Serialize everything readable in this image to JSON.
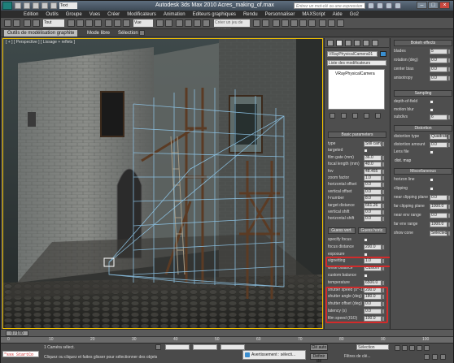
{
  "window": {
    "title": "Autodesk 3ds Max 2010     Acres_making_of.max",
    "help_search_placeholder": "Entrez un mot-clé ou une expression",
    "quick_access_dropdown": "Text"
  },
  "menu": [
    "Edition",
    "Outils",
    "Groupe",
    "Vues",
    "Créer",
    "Modificateurs",
    "Animation",
    "Editeurs graphiques",
    "Rendu",
    "Personnaliser",
    "MAXScript",
    "Aide",
    "Go2"
  ],
  "toolbar": {
    "dropdown_all": "Tout",
    "dropdown_vue": "Vue",
    "selection_set": "Créer un jeu de sélection"
  },
  "ribbon": {
    "tabs": [
      "Outils de modélisation graphite",
      "Mode libre",
      "Sélection"
    ]
  },
  "viewport": {
    "label": "[ + ] [ Perspective ] [ Lissage + reflets ]"
  },
  "command_panel": {
    "object_name": "VRayPhysicalCamera01",
    "modifier_list": "Liste des modificateurs",
    "modifier_item": "VRayPhysicalCamera",
    "rollout_title": "Basic parameters",
    "params": [
      {
        "label": "type",
        "value": "Still cam"
      },
      {
        "label": "targeted",
        "value": ""
      },
      {
        "label": "film gate (mm)",
        "value": "36.0"
      },
      {
        "label": "focal length (mm)",
        "value": "40.0"
      },
      {
        "label": "fov",
        "value": "48.455"
      },
      {
        "label": "zoom factor",
        "value": "1.0"
      },
      {
        "label": "horizontal offset",
        "value": "0.0"
      },
      {
        "label": "vertical offset",
        "value": "0.0"
      },
      {
        "label": "f-number",
        "value": "8.0"
      },
      {
        "label": "target distance",
        "value": "661.26"
      },
      {
        "label": "vertical shift",
        "value": "0.0"
      },
      {
        "label": "horizontal shift",
        "value": "0.0"
      }
    ],
    "guess_vert": "Guess vert.",
    "guess_horiz": "Guess horiz.",
    "params2": [
      {
        "label": "specify focus",
        "value": ""
      },
      {
        "label": "focus distance",
        "value": "200.0"
      },
      {
        "label": "exposure",
        "value": ""
      },
      {
        "label": "vignetting",
        "value": "1.0"
      },
      {
        "label": "white balance",
        "value": "Custom"
      },
      {
        "label": "custom balance",
        "value": ""
      },
      {
        "label": "temperature",
        "value": "6500.0"
      },
      {
        "label": "shutter speed (s^-1)",
        "value": "200.0"
      },
      {
        "label": "shutter angle (deg)",
        "value": "180.0"
      },
      {
        "label": "shutter offset (deg)",
        "value": "0.0"
      },
      {
        "label": "latency (s)",
        "value": "0.0"
      },
      {
        "label": "film speed (ISO)",
        "value": "100.0"
      }
    ]
  },
  "secondary_panel": {
    "bokeh": {
      "title": "Bokeh effects",
      "rows": [
        {
          "label": "blades",
          "value": "5"
        },
        {
          "label": "rotation (deg)",
          "value": "0.0"
        },
        {
          "label": "center bias",
          "value": "0.0"
        },
        {
          "label": "anisotropy",
          "value": "0.0"
        }
      ]
    },
    "sampling": {
      "title": "Sampling",
      "rows": [
        {
          "label": "depth-of-field",
          "value": ""
        },
        {
          "label": "motion blur",
          "value": ""
        },
        {
          "label": "subdivs",
          "value": "6"
        }
      ]
    },
    "distortion": {
      "title": "Distortion",
      "rows": [
        {
          "label": "distortion type",
          "value": "Quadratic"
        },
        {
          "label": "distortion amount",
          "value": "0.0"
        },
        {
          "label": "Lens file",
          "value": ""
        }
      ],
      "dist_map": "dist. map"
    },
    "misc": {
      "title": "Miscellaneous",
      "rows": [
        {
          "label": "horizon line",
          "value": ""
        },
        {
          "label": "clipping",
          "value": ""
        },
        {
          "label": "near clipping plane",
          "value": "0.0"
        },
        {
          "label": "far clipping plane",
          "value": "1000.0"
        },
        {
          "label": "near env range",
          "value": "0.0"
        },
        {
          "label": "far env range",
          "value": "1000.0"
        },
        {
          "label": "show cone",
          "value": "Selected"
        }
      ]
    }
  },
  "timeline": {
    "slider": "0 / 100",
    "ticks": [
      "0",
      "10",
      "20",
      "30",
      "40",
      "50",
      "60",
      "70",
      "80",
      "90",
      "100"
    ]
  },
  "status": {
    "maxscript": "\"sss StartCo",
    "selected": "1 Caméra sélect.",
    "prompt": "Cliquez ou cliquez et faites glisser pour sélectionner des objets",
    "warning": "Avertissement : sélecti...",
    "selection_dd": "Sélection",
    "filters": "Filtres de clé...",
    "autokey": "Clé auto",
    "setkey": "Définir clé"
  }
}
